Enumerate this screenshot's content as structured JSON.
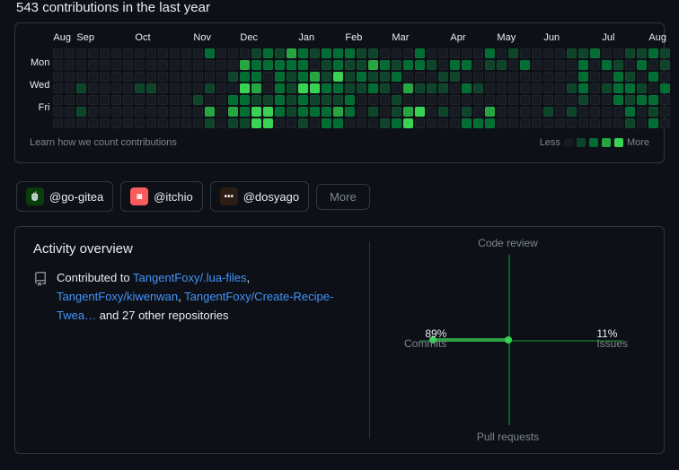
{
  "header": {
    "title": "543 contributions in the last year"
  },
  "days": [
    "Mon",
    "Wed",
    "Fri"
  ],
  "months": [
    {
      "label": "Aug",
      "col": 0
    },
    {
      "label": "Sep",
      "col": 2
    },
    {
      "label": "Oct",
      "col": 7
    },
    {
      "label": "Nov",
      "col": 12
    },
    {
      "label": "Dec",
      "col": 16
    },
    {
      "label": "Jan",
      "col": 21
    },
    {
      "label": "Feb",
      "col": 25
    },
    {
      "label": "Mar",
      "col": 29
    },
    {
      "label": "Apr",
      "col": 34
    },
    {
      "label": "May",
      "col": 38
    },
    {
      "label": "Jun",
      "col": 42
    },
    {
      "label": "Jul",
      "col": 47
    },
    {
      "label": "Aug",
      "col": 51
    }
  ],
  "footer": {
    "learn": "Learn how we count contributions",
    "less": "Less",
    "more": "More"
  },
  "orgs": [
    {
      "label": "@go-gitea",
      "bg": "#0b3d0b",
      "icon": "🍵"
    },
    {
      "label": "@itchio",
      "bg": "#fa5c5c",
      "icon": "◙"
    },
    {
      "label": "@dosyago",
      "bg": "#2d1e15",
      "icon": "•••"
    }
  ],
  "more_btn": "More",
  "overview": {
    "title": "Activity overview",
    "prefix": "Contributed to ",
    "repos": [
      "TangentFoxy/.lua-files",
      "TangentFoxy/kiwenwan",
      "TangentFoxy/Create-Recipe-Twea…"
    ],
    "suffix": "and 27 other repositories",
    "axes": {
      "top": "Code review",
      "bottom": "Pull requests",
      "left": "Commits",
      "right": "Issues"
    },
    "left_pct": "89%",
    "right_pct": "11%"
  },
  "chart_data": {
    "type": "heatmap",
    "title": "543 contributions in the last year",
    "weeks": 53,
    "days_per_week": 7,
    "levels": [
      0,
      1,
      2,
      3,
      4
    ],
    "cells": [
      [
        0,
        0,
        0,
        0,
        0,
        0,
        0
      ],
      [
        0,
        0,
        0,
        0,
        0,
        0,
        0
      ],
      [
        0,
        0,
        0,
        1,
        0,
        1,
        0
      ],
      [
        0,
        0,
        0,
        0,
        0,
        0,
        0
      ],
      [
        0,
        0,
        0,
        0,
        0,
        0,
        0
      ],
      [
        0,
        0,
        0,
        0,
        0,
        0,
        0
      ],
      [
        0,
        0,
        0,
        0,
        0,
        0,
        0
      ],
      [
        0,
        0,
        0,
        1,
        0,
        0,
        0
      ],
      [
        0,
        0,
        0,
        1,
        0,
        0,
        0
      ],
      [
        0,
        0,
        0,
        0,
        0,
        0,
        0
      ],
      [
        0,
        0,
        0,
        0,
        0,
        0,
        0
      ],
      [
        0,
        0,
        0,
        0,
        0,
        0,
        0
      ],
      [
        0,
        0,
        0,
        0,
        1,
        0,
        0
      ],
      [
        2,
        0,
        0,
        1,
        0,
        3,
        1
      ],
      [
        0,
        0,
        0,
        0,
        0,
        0,
        0
      ],
      [
        0,
        0,
        1,
        0,
        2,
        3,
        1
      ],
      [
        0,
        3,
        2,
        4,
        2,
        2,
        1
      ],
      [
        1,
        2,
        2,
        3,
        1,
        4,
        4
      ],
      [
        2,
        2,
        0,
        0,
        1,
        4,
        4
      ],
      [
        1,
        2,
        2,
        2,
        2,
        2,
        0
      ],
      [
        3,
        2,
        1,
        1,
        1,
        1,
        0
      ],
      [
        2,
        2,
        2,
        4,
        2,
        2,
        1
      ],
      [
        1,
        0,
        3,
        4,
        1,
        2,
        0
      ],
      [
        2,
        1,
        1,
        2,
        1,
        2,
        2
      ],
      [
        2,
        2,
        4,
        2,
        1,
        3,
        2
      ],
      [
        2,
        1,
        1,
        1,
        2,
        2,
        0
      ],
      [
        1,
        1,
        2,
        1,
        0,
        0,
        0
      ],
      [
        1,
        3,
        1,
        2,
        0,
        1,
        0
      ],
      [
        0,
        2,
        1,
        1,
        0,
        0,
        1
      ],
      [
        0,
        1,
        2,
        0,
        1,
        1,
        2
      ],
      [
        0,
        2,
        0,
        3,
        0,
        3,
        4
      ],
      [
        2,
        2,
        0,
        1,
        0,
        4,
        0
      ],
      [
        0,
        1,
        0,
        1,
        0,
        0,
        0
      ],
      [
        0,
        0,
        1,
        1,
        0,
        1,
        0
      ],
      [
        0,
        2,
        1,
        0,
        0,
        0,
        0
      ],
      [
        0,
        2,
        0,
        2,
        0,
        1,
        2
      ],
      [
        0,
        0,
        0,
        1,
        0,
        0,
        2
      ],
      [
        2,
        1,
        0,
        0,
        0,
        3,
        2
      ],
      [
        0,
        1,
        0,
        0,
        0,
        0,
        0
      ],
      [
        1,
        0,
        0,
        0,
        0,
        0,
        0
      ],
      [
        0,
        2,
        0,
        0,
        0,
        0,
        0
      ],
      [
        0,
        0,
        0,
        0,
        0,
        0,
        0
      ],
      [
        0,
        0,
        0,
        0,
        0,
        1,
        0
      ],
      [
        0,
        0,
        0,
        0,
        0,
        0,
        0
      ],
      [
        1,
        0,
        0,
        1,
        0,
        1,
        0
      ],
      [
        1,
        2,
        2,
        2,
        1,
        0,
        0
      ],
      [
        2,
        0,
        0,
        0,
        0,
        0,
        0
      ],
      [
        0,
        2,
        0,
        1,
        0,
        0,
        0
      ],
      [
        0,
        1,
        2,
        2,
        2,
        0,
        0
      ],
      [
        1,
        0,
        1,
        2,
        1,
        2,
        1
      ],
      [
        1,
        2,
        0,
        1,
        2,
        0,
        0
      ],
      [
        2,
        0,
        2,
        0,
        2,
        1,
        2
      ],
      [
        1,
        1,
        0,
        2,
        0,
        0,
        0
      ]
    ],
    "activity_axes": {
      "commits": 89,
      "issues": 11,
      "code_review": 0,
      "pull_requests": 0
    }
  }
}
